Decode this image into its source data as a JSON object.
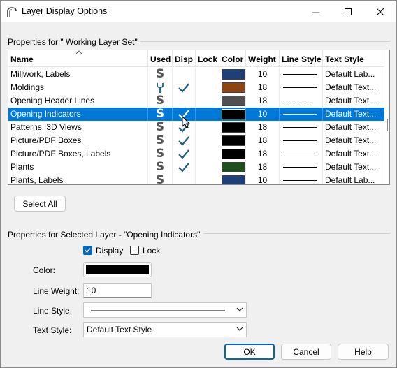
{
  "window": {
    "title": "Layer Display Options"
  },
  "layerset": {
    "section_title": "Properties for \" Working Layer Set\"",
    "columns": [
      "Name",
      "Used",
      "Disp",
      "Lock",
      "Color",
      "Weight",
      "Line Style",
      "Text Style"
    ],
    "rows": [
      {
        "name": "Millwork, Labels",
        "used": "S",
        "disp": false,
        "color": "#1f3f78",
        "weight": "10",
        "line": "solid",
        "text": "Default Lab..."
      },
      {
        "name": "Moldings",
        "used": "wrench",
        "disp": true,
        "color": "#8b4513",
        "weight": "18",
        "line": "solid",
        "text": "Default Text..."
      },
      {
        "name": "Opening Header Lines",
        "used": "S",
        "disp": false,
        "color": "#505050",
        "weight": "18",
        "line": "dashed",
        "text": "Default Text..."
      },
      {
        "name": "Opening Indicators",
        "used": "S",
        "disp": true,
        "color": "#000000",
        "weight": "10",
        "line": "solid",
        "text": "Default Text...",
        "selected": true
      },
      {
        "name": "Patterns, 3D Views",
        "used": "S",
        "disp": true,
        "color": "#000000",
        "weight": "18",
        "line": "solid",
        "text": "Default Text..."
      },
      {
        "name": "Picture/PDF Boxes",
        "used": "S",
        "disp": true,
        "color": "#000000",
        "weight": "18",
        "line": "solid",
        "text": "Default Text..."
      },
      {
        "name": "Picture/PDF Boxes, Labels",
        "used": "S",
        "disp": true,
        "color": "#000000",
        "weight": "18",
        "line": "solid",
        "text": "Default Text..."
      },
      {
        "name": "Plants",
        "used": "S",
        "disp": true,
        "color": "#1f4f1f",
        "weight": "18",
        "line": "solid",
        "text": "Default Text..."
      },
      {
        "name": "Plants, Labels",
        "used": "S",
        "disp": false,
        "color": "#1f3f78",
        "weight": "10",
        "line": "solid",
        "text": "Default Lab..."
      }
    ],
    "select_all_label": "Select All"
  },
  "selected_layer": {
    "section_title": "Properties for Selected Layer - \"Opening Indicators\"",
    "display_label": "Display",
    "display_checked": true,
    "lock_label": "Lock",
    "lock_checked": false,
    "color_label": "Color:",
    "color_value": "#000000",
    "weight_label": "Line Weight:",
    "weight_value": "10",
    "linestyle_label": "Line Style:",
    "textstyle_label": "Text Style:",
    "textstyle_value": "Default Text Style"
  },
  "buttons": {
    "ok": "OK",
    "cancel": "Cancel",
    "help": "Help"
  },
  "colors": {
    "accent": "#0078d7",
    "check": "#1f5f7f"
  }
}
